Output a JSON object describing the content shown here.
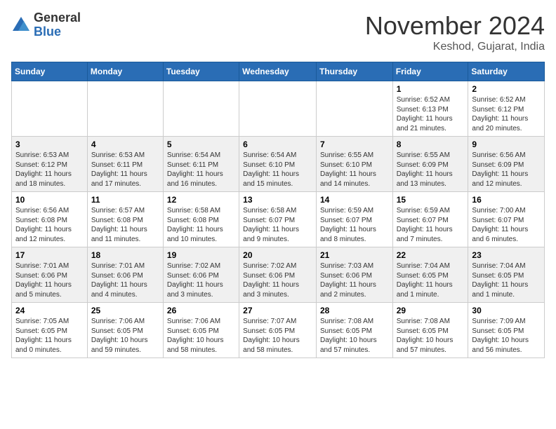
{
  "header": {
    "logo_general": "General",
    "logo_blue": "Blue",
    "month": "November 2024",
    "location": "Keshod, Gujarat, India"
  },
  "weekdays": [
    "Sunday",
    "Monday",
    "Tuesday",
    "Wednesday",
    "Thursday",
    "Friday",
    "Saturday"
  ],
  "weeks": [
    [
      {
        "day": "",
        "info": ""
      },
      {
        "day": "",
        "info": ""
      },
      {
        "day": "",
        "info": ""
      },
      {
        "day": "",
        "info": ""
      },
      {
        "day": "",
        "info": ""
      },
      {
        "day": "1",
        "info": "Sunrise: 6:52 AM\nSunset: 6:13 PM\nDaylight: 11 hours\nand 21 minutes."
      },
      {
        "day": "2",
        "info": "Sunrise: 6:52 AM\nSunset: 6:12 PM\nDaylight: 11 hours\nand 20 minutes."
      }
    ],
    [
      {
        "day": "3",
        "info": "Sunrise: 6:53 AM\nSunset: 6:12 PM\nDaylight: 11 hours\nand 18 minutes."
      },
      {
        "day": "4",
        "info": "Sunrise: 6:53 AM\nSunset: 6:11 PM\nDaylight: 11 hours\nand 17 minutes."
      },
      {
        "day": "5",
        "info": "Sunrise: 6:54 AM\nSunset: 6:11 PM\nDaylight: 11 hours\nand 16 minutes."
      },
      {
        "day": "6",
        "info": "Sunrise: 6:54 AM\nSunset: 6:10 PM\nDaylight: 11 hours\nand 15 minutes."
      },
      {
        "day": "7",
        "info": "Sunrise: 6:55 AM\nSunset: 6:10 PM\nDaylight: 11 hours\nand 14 minutes."
      },
      {
        "day": "8",
        "info": "Sunrise: 6:55 AM\nSunset: 6:09 PM\nDaylight: 11 hours\nand 13 minutes."
      },
      {
        "day": "9",
        "info": "Sunrise: 6:56 AM\nSunset: 6:09 PM\nDaylight: 11 hours\nand 12 minutes."
      }
    ],
    [
      {
        "day": "10",
        "info": "Sunrise: 6:56 AM\nSunset: 6:08 PM\nDaylight: 11 hours\nand 12 minutes."
      },
      {
        "day": "11",
        "info": "Sunrise: 6:57 AM\nSunset: 6:08 PM\nDaylight: 11 hours\nand 11 minutes."
      },
      {
        "day": "12",
        "info": "Sunrise: 6:58 AM\nSunset: 6:08 PM\nDaylight: 11 hours\nand 10 minutes."
      },
      {
        "day": "13",
        "info": "Sunrise: 6:58 AM\nSunset: 6:07 PM\nDaylight: 11 hours\nand 9 minutes."
      },
      {
        "day": "14",
        "info": "Sunrise: 6:59 AM\nSunset: 6:07 PM\nDaylight: 11 hours\nand 8 minutes."
      },
      {
        "day": "15",
        "info": "Sunrise: 6:59 AM\nSunset: 6:07 PM\nDaylight: 11 hours\nand 7 minutes."
      },
      {
        "day": "16",
        "info": "Sunrise: 7:00 AM\nSunset: 6:07 PM\nDaylight: 11 hours\nand 6 minutes."
      }
    ],
    [
      {
        "day": "17",
        "info": "Sunrise: 7:01 AM\nSunset: 6:06 PM\nDaylight: 11 hours\nand 5 minutes."
      },
      {
        "day": "18",
        "info": "Sunrise: 7:01 AM\nSunset: 6:06 PM\nDaylight: 11 hours\nand 4 minutes."
      },
      {
        "day": "19",
        "info": "Sunrise: 7:02 AM\nSunset: 6:06 PM\nDaylight: 11 hours\nand 3 minutes."
      },
      {
        "day": "20",
        "info": "Sunrise: 7:02 AM\nSunset: 6:06 PM\nDaylight: 11 hours\nand 3 minutes."
      },
      {
        "day": "21",
        "info": "Sunrise: 7:03 AM\nSunset: 6:06 PM\nDaylight: 11 hours\nand 2 minutes."
      },
      {
        "day": "22",
        "info": "Sunrise: 7:04 AM\nSunset: 6:05 PM\nDaylight: 11 hours\nand 1 minute."
      },
      {
        "day": "23",
        "info": "Sunrise: 7:04 AM\nSunset: 6:05 PM\nDaylight: 11 hours\nand 1 minute."
      }
    ],
    [
      {
        "day": "24",
        "info": "Sunrise: 7:05 AM\nSunset: 6:05 PM\nDaylight: 11 hours\nand 0 minutes."
      },
      {
        "day": "25",
        "info": "Sunrise: 7:06 AM\nSunset: 6:05 PM\nDaylight: 10 hours\nand 59 minutes."
      },
      {
        "day": "26",
        "info": "Sunrise: 7:06 AM\nSunset: 6:05 PM\nDaylight: 10 hours\nand 58 minutes."
      },
      {
        "day": "27",
        "info": "Sunrise: 7:07 AM\nSunset: 6:05 PM\nDaylight: 10 hours\nand 58 minutes."
      },
      {
        "day": "28",
        "info": "Sunrise: 7:08 AM\nSunset: 6:05 PM\nDaylight: 10 hours\nand 57 minutes."
      },
      {
        "day": "29",
        "info": "Sunrise: 7:08 AM\nSunset: 6:05 PM\nDaylight: 10 hours\nand 57 minutes."
      },
      {
        "day": "30",
        "info": "Sunrise: 7:09 AM\nSunset: 6:05 PM\nDaylight: 10 hours\nand 56 minutes."
      }
    ]
  ]
}
